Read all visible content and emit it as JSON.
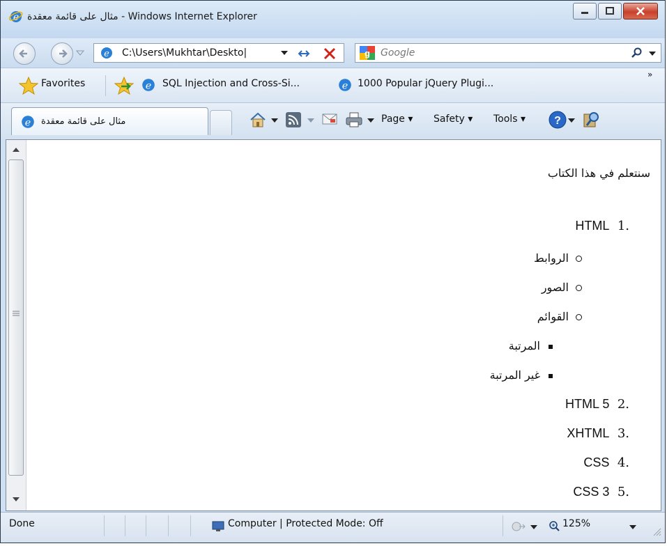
{
  "window": {
    "title": "مثال على قائمة معقدة - Windows Internet Explorer",
    "controls": [
      "minimize",
      "maximize",
      "close"
    ]
  },
  "address_bar": {
    "url": "C:\\Users\\Mukhtar\\Deskto|",
    "search_placeholder": "Google"
  },
  "favorites_bar": {
    "favorites_label": "Favorites",
    "items": [
      "SQL Injection and Cross-Si...",
      "1000 Popular jQuery Plugi..."
    ],
    "overflow": "»"
  },
  "tab": {
    "label": "مثال على قائمة معقدة"
  },
  "command_bar": {
    "page": "Page ▾",
    "safety": "Safety ▾",
    "tools": "Tools ▾"
  },
  "page": {
    "intro": "سنتعلم في هذا الكتاب",
    "list": [
      {
        "num": ".1",
        "label": "HTML"
      },
      {
        "num": ".2",
        "label": "HTML 5"
      },
      {
        "num": ".3",
        "label": "XHTML"
      },
      {
        "num": ".4",
        "label": "CSS"
      },
      {
        "num": ".5",
        "label": "CSS 3"
      }
    ],
    "sublist": [
      "الروابط",
      "الصور",
      "القوائم"
    ],
    "subsublist": [
      "المرتبة",
      "غير المرتبة"
    ]
  },
  "status_bar": {
    "status": "Done",
    "zone": "Computer | Protected Mode: Off",
    "zoom": "125%"
  }
}
